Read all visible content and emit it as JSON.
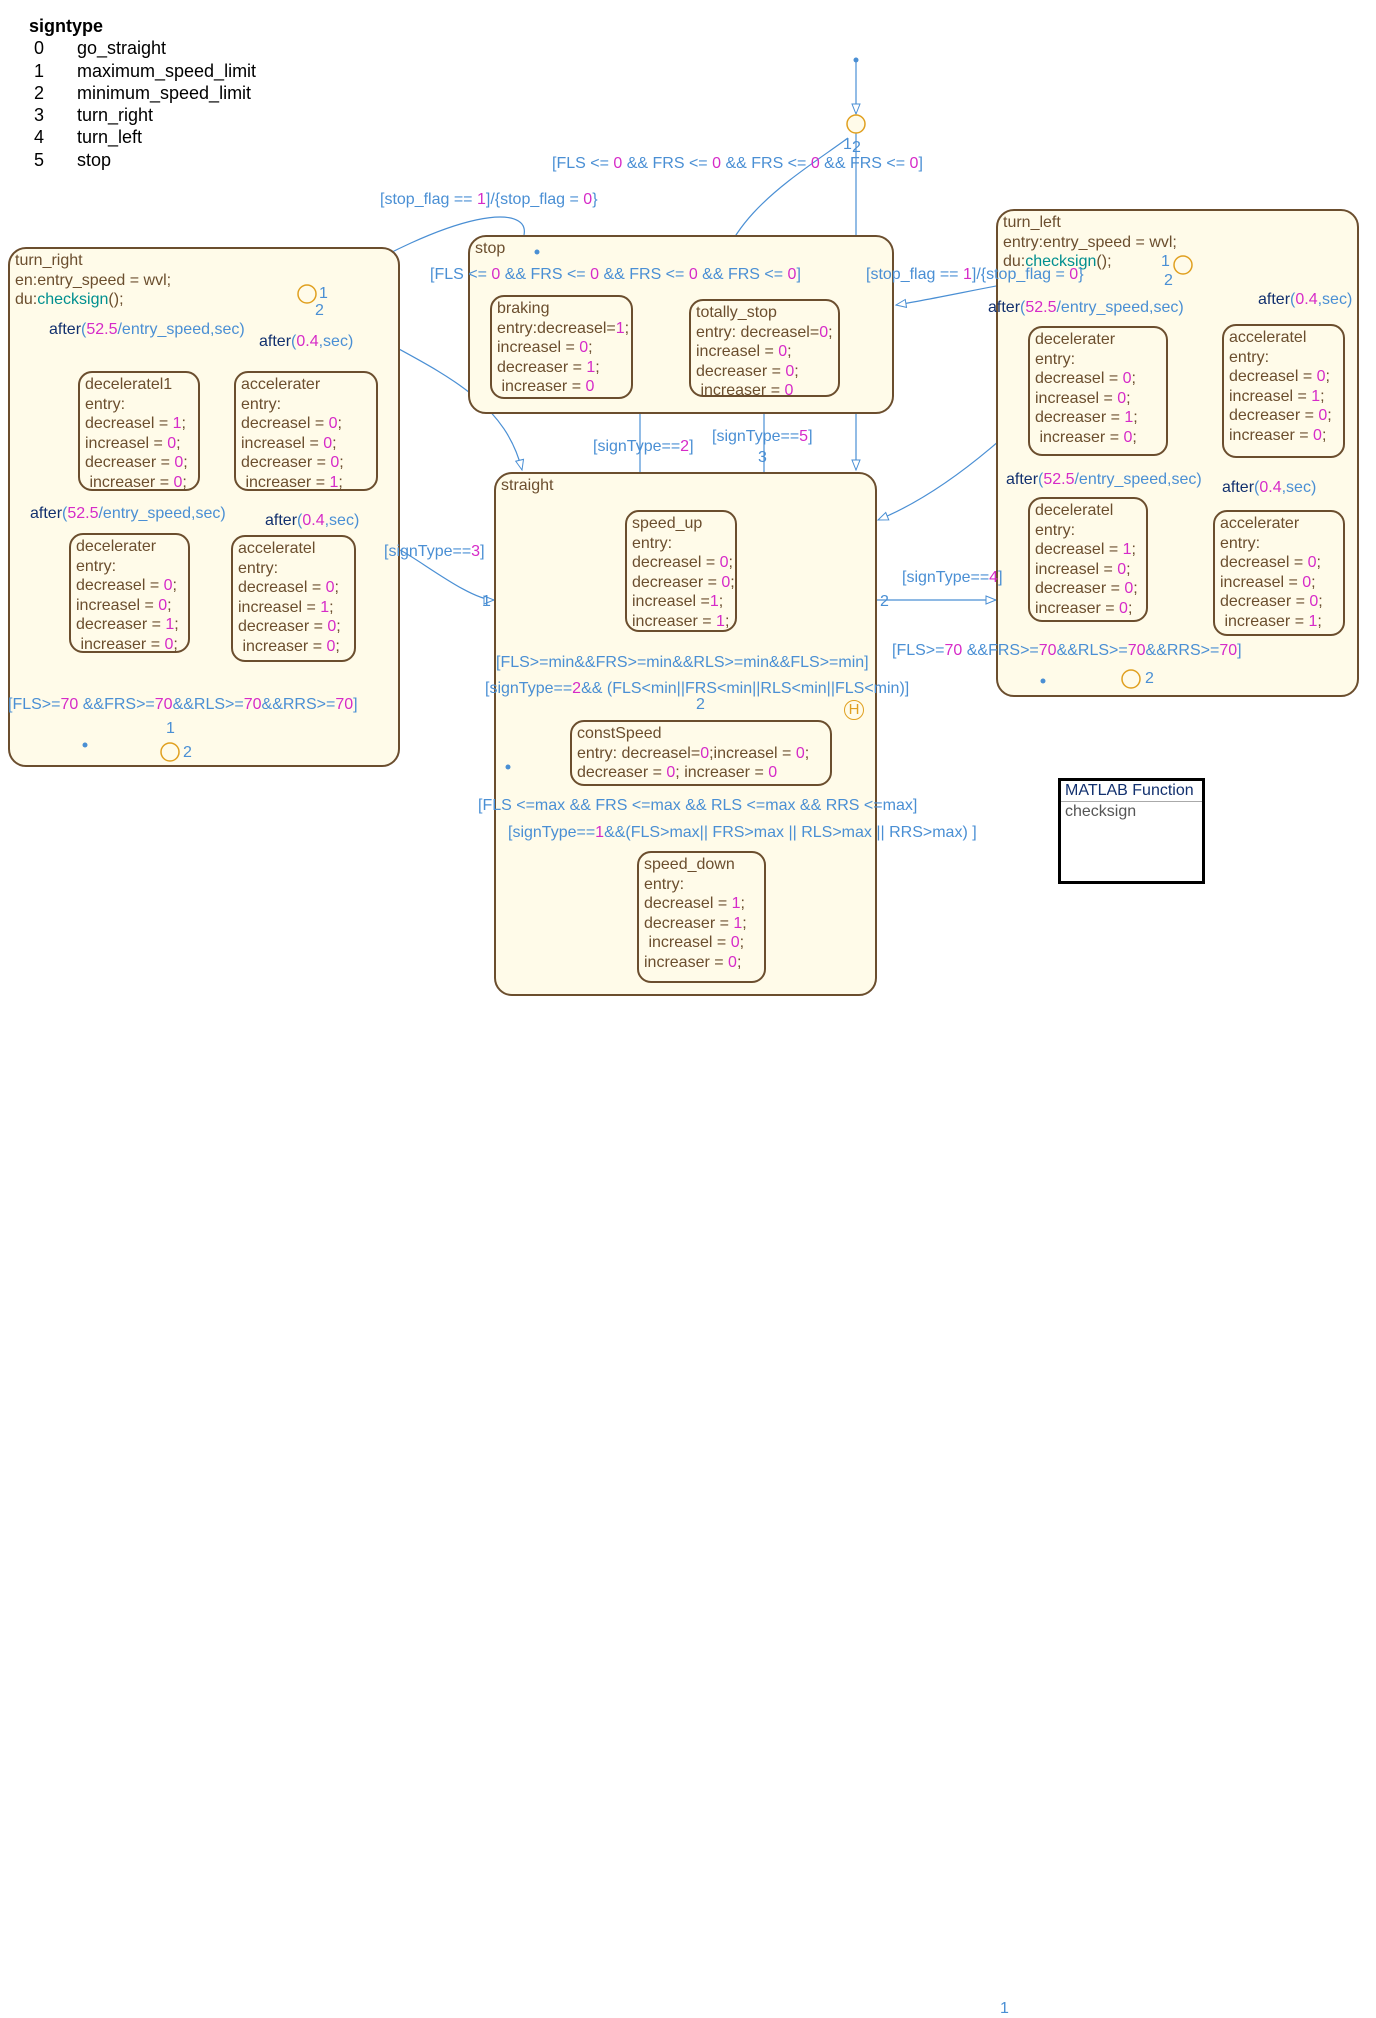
{
  "legend": {
    "title": "signtype",
    "rows": [
      [
        "0",
        "go_straight"
      ],
      [
        "1",
        "maximum_speed_limit"
      ],
      [
        "2",
        "minimum_speed_limit"
      ],
      [
        "3",
        "turn_right"
      ],
      [
        "4",
        "turn_left"
      ],
      [
        "5",
        "stop"
      ]
    ]
  },
  "colors": {
    "state_border": "#6b4e2e",
    "state_fill": "#fffbe9",
    "transition": "#4a8fd4",
    "junction": "#e0a020",
    "number": "#d62bc8",
    "function": "#008f8f"
  },
  "states": {
    "turn_right": [
      [
        [
          "turn_right",
          "b"
        ]
      ],
      [
        [
          "en:entry_speed = wvl;",
          "b"
        ]
      ],
      [
        [
          "du:",
          "b"
        ],
        [
          "checksign",
          "t"
        ],
        [
          "();",
          "b"
        ]
      ]
    ],
    "deceleratel1": [
      [
        [
          "deceleratel1",
          "b"
        ]
      ],
      [
        [
          "entry:",
          "b"
        ]
      ],
      [
        [
          "decreasel = ",
          "b"
        ],
        [
          "1",
          "m"
        ],
        [
          ";",
          "b"
        ]
      ],
      [
        [
          "increasel = ",
          "b"
        ],
        [
          "0",
          "m"
        ],
        [
          ";",
          "b"
        ]
      ],
      [
        [
          "decreaser = ",
          "b"
        ],
        [
          "0",
          "m"
        ],
        [
          ";",
          "b"
        ]
      ],
      [
        [
          " increaser = ",
          "b"
        ],
        [
          "0",
          "m"
        ],
        [
          ";",
          "b"
        ]
      ]
    ],
    "tr_accelerater": [
      [
        [
          "accelerater",
          "b"
        ]
      ],
      [
        [
          "entry:",
          "b"
        ]
      ],
      [
        [
          "decreasel = ",
          "b"
        ],
        [
          "0",
          "m"
        ],
        [
          ";",
          "b"
        ]
      ],
      [
        [
          "increasel = ",
          "b"
        ],
        [
          "0",
          "m"
        ],
        [
          ";",
          "b"
        ]
      ],
      [
        [
          "decreaser = ",
          "b"
        ],
        [
          "0",
          "m"
        ],
        [
          ";",
          "b"
        ]
      ],
      [
        [
          " increaser = ",
          "b"
        ],
        [
          "1",
          "m"
        ],
        [
          ";",
          "b"
        ]
      ]
    ],
    "tr_decelerater": [
      [
        [
          "decelerater",
          "b"
        ]
      ],
      [
        [
          "entry:",
          "b"
        ]
      ],
      [
        [
          "decreasel = ",
          "b"
        ],
        [
          "0",
          "m"
        ],
        [
          ";",
          "b"
        ]
      ],
      [
        [
          "increasel = ",
          "b"
        ],
        [
          "0",
          "m"
        ],
        [
          ";",
          "b"
        ]
      ],
      [
        [
          "decreaser = ",
          "b"
        ],
        [
          "1",
          "m"
        ],
        [
          ";",
          "b"
        ]
      ],
      [
        [
          " increaser = ",
          "b"
        ],
        [
          "0",
          "m"
        ],
        [
          ";",
          "b"
        ]
      ]
    ],
    "tr_acceleratel": [
      [
        [
          "acceleratel",
          "b"
        ]
      ],
      [
        [
          "entry:",
          "b"
        ]
      ],
      [
        [
          "decreasel = ",
          "b"
        ],
        [
          "0",
          "m"
        ],
        [
          ";",
          "b"
        ]
      ],
      [
        [
          "increasel = ",
          "b"
        ],
        [
          "1",
          "m"
        ],
        [
          ";",
          "b"
        ]
      ],
      [
        [
          "decreaser = ",
          "b"
        ],
        [
          "0",
          "m"
        ],
        [
          ";",
          "b"
        ]
      ],
      [
        [
          " increaser = ",
          "b"
        ],
        [
          "0",
          "m"
        ],
        [
          ";",
          "b"
        ]
      ]
    ],
    "stop": [
      [
        [
          "stop",
          "b"
        ]
      ]
    ],
    "braking": [
      [
        [
          "braking",
          "b"
        ]
      ],
      [
        [
          "entry:decreasel=",
          "b"
        ],
        [
          "1",
          "m"
        ],
        [
          ";",
          "b"
        ]
      ],
      [
        [
          "increasel = ",
          "b"
        ],
        [
          "0",
          "m"
        ],
        [
          ";",
          "b"
        ]
      ],
      [
        [
          "decreaser = ",
          "b"
        ],
        [
          "1",
          "m"
        ],
        [
          ";",
          "b"
        ]
      ],
      [
        [
          " increaser = ",
          "b"
        ],
        [
          "0",
          "m"
        ]
      ]
    ],
    "totally_stop": [
      [
        [
          "totally_stop",
          "b"
        ]
      ],
      [
        [
          "entry: decreasel=",
          "b"
        ],
        [
          "0",
          "m"
        ],
        [
          ";",
          "b"
        ]
      ],
      [
        [
          "increasel = ",
          "b"
        ],
        [
          "0",
          "m"
        ],
        [
          ";",
          "b"
        ]
      ],
      [
        [
          "decreaser = ",
          "b"
        ],
        [
          "0",
          "m"
        ],
        [
          ";",
          "b"
        ]
      ],
      [
        [
          " increaser = ",
          "b"
        ],
        [
          "0",
          "m"
        ]
      ]
    ],
    "straight": [
      [
        [
          "straight",
          "b"
        ]
      ]
    ],
    "speed_up": [
      [
        [
          "speed_up",
          "b"
        ]
      ],
      [
        [
          "entry:",
          "b"
        ]
      ],
      [
        [
          "decreasel = ",
          "b"
        ],
        [
          "0",
          "m"
        ],
        [
          ";",
          "b"
        ]
      ],
      [
        [
          "decreaser = ",
          "b"
        ],
        [
          "0",
          "m"
        ],
        [
          ";",
          "b"
        ]
      ],
      [
        [
          "increasel =",
          "b"
        ],
        [
          "1",
          "m"
        ],
        [
          ";",
          "b"
        ]
      ],
      [
        [
          "increaser = ",
          "b"
        ],
        [
          "1",
          "m"
        ],
        [
          ";",
          "b"
        ]
      ]
    ],
    "constSpeed": [
      [
        [
          "constSpeed",
          "b"
        ]
      ],
      [
        [
          "entry: decreasel=",
          "b"
        ],
        [
          "0",
          "m"
        ],
        [
          ";increasel = ",
          "b"
        ],
        [
          "0",
          "m"
        ],
        [
          ";",
          "b"
        ]
      ],
      [
        [
          "decreaser = ",
          "b"
        ],
        [
          "0",
          "m"
        ],
        [
          "; increaser = ",
          "b"
        ],
        [
          "0",
          "m"
        ]
      ]
    ],
    "speed_down": [
      [
        [
          "speed_down",
          "b"
        ]
      ],
      [
        [
          "entry:",
          "b"
        ]
      ],
      [
        [
          "decreasel = ",
          "b"
        ],
        [
          "1",
          "m"
        ],
        [
          ";",
          "b"
        ]
      ],
      [
        [
          "decreaser = ",
          "b"
        ],
        [
          "1",
          "m"
        ],
        [
          ";",
          "b"
        ]
      ],
      [
        [
          " increasel = ",
          "b"
        ],
        [
          "0",
          "m"
        ],
        [
          ";",
          "b"
        ]
      ],
      [
        [
          "increaser = ",
          "b"
        ],
        [
          "0",
          "m"
        ],
        [
          ";",
          "b"
        ]
      ]
    ],
    "turn_left": [
      [
        [
          "turn_left",
          "b"
        ]
      ],
      [
        [
          "entry:entry_speed = wvl;",
          "b"
        ]
      ],
      [
        [
          "du:",
          "b"
        ],
        [
          "checksign",
          "t"
        ],
        [
          "();",
          "b"
        ]
      ]
    ],
    "tl_decelerater": [
      [
        [
          "decelerater",
          "b"
        ]
      ],
      [
        [
          "entry:",
          "b"
        ]
      ],
      [
        [
          "decreasel = ",
          "b"
        ],
        [
          "0",
          "m"
        ],
        [
          ";",
          "b"
        ]
      ],
      [
        [
          "increasel = ",
          "b"
        ],
        [
          "0",
          "m"
        ],
        [
          ";",
          "b"
        ]
      ],
      [
        [
          "decreaser = ",
          "b"
        ],
        [
          "1",
          "m"
        ],
        [
          ";",
          "b"
        ]
      ],
      [
        [
          " increaser = ",
          "b"
        ],
        [
          "0",
          "m"
        ],
        [
          ";",
          "b"
        ]
      ]
    ],
    "tl_acceleratel": [
      [
        [
          "acceleratel",
          "b"
        ]
      ],
      [
        [
          "entry:",
          "b"
        ]
      ],
      [
        [
          "decreasel = ",
          "b"
        ],
        [
          "0",
          "m"
        ],
        [
          ";",
          "b"
        ]
      ],
      [
        [
          "increasel = ",
          "b"
        ],
        [
          "1",
          "m"
        ],
        [
          ";",
          "b"
        ]
      ],
      [
        [
          "decreaser = ",
          "b"
        ],
        [
          "0",
          "m"
        ],
        [
          ";",
          "b"
        ]
      ],
      [
        [
          "increaser = ",
          "b"
        ],
        [
          "0",
          "m"
        ],
        [
          ";",
          "b"
        ]
      ]
    ],
    "tl_deceleratel": [
      [
        [
          "deceleratel",
          "b"
        ]
      ],
      [
        [
          "entry:",
          "b"
        ]
      ],
      [
        [
          "decreasel = ",
          "b"
        ],
        [
          "1",
          "m"
        ],
        [
          ";",
          "b"
        ]
      ],
      [
        [
          "increasel = ",
          "b"
        ],
        [
          "0",
          "m"
        ],
        [
          ";",
          "b"
        ]
      ],
      [
        [
          "decreaser = ",
          "b"
        ],
        [
          "0",
          "m"
        ],
        [
          ";",
          "b"
        ]
      ],
      [
        [
          "increaser = ",
          "b"
        ],
        [
          "0",
          "m"
        ],
        [
          ";",
          "b"
        ]
      ]
    ],
    "tl_accelerater": [
      [
        [
          "accelerater",
          "b"
        ]
      ],
      [
        [
          "entry:",
          "b"
        ]
      ],
      [
        [
          "decreasel = ",
          "b"
        ],
        [
          "0",
          "m"
        ],
        [
          ";",
          "b"
        ]
      ],
      [
        [
          "increasel = ",
          "b"
        ],
        [
          "0",
          "m"
        ],
        [
          ";",
          "b"
        ]
      ],
      [
        [
          "decreaser = ",
          "b"
        ],
        [
          "0",
          "m"
        ],
        [
          ";",
          "b"
        ]
      ],
      [
        [
          " increaser = ",
          "b"
        ],
        [
          "1",
          "m"
        ],
        [
          ";",
          "b"
        ]
      ]
    ]
  },
  "labels": {
    "top_guard": [
      [
        "[FLS <= ",
        "l"
      ],
      [
        "0",
        "m"
      ],
      [
        " && FRS <= ",
        "l"
      ],
      [
        "0",
        "m"
      ],
      [
        " && FRS <= ",
        "l"
      ],
      [
        "0",
        "m"
      ],
      [
        " && FRS <= ",
        "l"
      ],
      [
        "0",
        "m"
      ],
      [
        "]",
        "l"
      ]
    ],
    "stopflag_left": [
      [
        "[stop_flag == ",
        "l"
      ],
      [
        "1",
        "m"
      ],
      [
        "]/{stop_flag = ",
        "l"
      ],
      [
        "0",
        "m"
      ],
      [
        "}",
        "l"
      ]
    ],
    "stop_guard": [
      [
        "[FLS <= ",
        "l"
      ],
      [
        "0",
        "m"
      ],
      [
        " && FRS <= ",
        "l"
      ],
      [
        "0",
        "m"
      ],
      [
        " && FRS <= ",
        "l"
      ],
      [
        "0",
        "m"
      ],
      [
        " && FRS <= ",
        "l"
      ],
      [
        "0",
        "m"
      ],
      [
        "]",
        "l"
      ]
    ],
    "stopflag_right": [
      [
        "[stop_flag == ",
        "l"
      ],
      [
        "1",
        "m"
      ],
      [
        "]/{stop_flag = ",
        "l"
      ],
      [
        "0",
        "m"
      ],
      [
        "}",
        "l"
      ]
    ],
    "sign2": [
      [
        "[signType==",
        "l"
      ],
      [
        "2",
        "m"
      ],
      [
        "]",
        "l"
      ]
    ],
    "sign5": [
      [
        "[signType==",
        "l"
      ],
      [
        "5",
        "m"
      ],
      [
        "]",
        "l"
      ]
    ],
    "sign3": [
      [
        "[signType==",
        "l"
      ],
      [
        "3",
        "m"
      ],
      [
        "]",
        "l"
      ]
    ],
    "sign4": [
      [
        "[signType==",
        "l"
      ],
      [
        "4",
        "m"
      ],
      [
        "]",
        "l"
      ]
    ],
    "tr_after1": [
      [
        "after",
        "d"
      ],
      [
        "(",
        "l"
      ],
      [
        "52.5",
        "m"
      ],
      [
        "/entry_speed,sec)",
        "l"
      ]
    ],
    "tr_after2": [
      [
        "after",
        "d"
      ],
      [
        "(",
        "l"
      ],
      [
        "0.4",
        "m"
      ],
      [
        ",sec)",
        "l"
      ]
    ],
    "tr_after3": [
      [
        "after",
        "d"
      ],
      [
        "(",
        "l"
      ],
      [
        "52.5",
        "m"
      ],
      [
        "/entry_speed,sec)",
        "l"
      ]
    ],
    "tr_after4": [
      [
        "after",
        "d"
      ],
      [
        "(",
        "l"
      ],
      [
        "0.4",
        "m"
      ],
      [
        ",sec)",
        "l"
      ]
    ],
    "tr_70": [
      [
        "[FLS>=",
        "l"
      ],
      [
        "70",
        "m"
      ],
      [
        " &&FRS>=",
        "l"
      ],
      [
        "70",
        "m"
      ],
      [
        "&&RLS>=",
        "l"
      ],
      [
        "70",
        "m"
      ],
      [
        "&&RRS>=",
        "l"
      ],
      [
        "70",
        "m"
      ],
      [
        "]",
        "l"
      ]
    ],
    "tl_after1": [
      [
        "after",
        "d"
      ],
      [
        "(",
        "l"
      ],
      [
        "52.5",
        "m"
      ],
      [
        "/entry_speed,sec)",
        "l"
      ]
    ],
    "tl_after2": [
      [
        "after",
        "d"
      ],
      [
        "(",
        "l"
      ],
      [
        "0.4",
        "m"
      ],
      [
        ",sec)",
        "l"
      ]
    ],
    "tl_after3": [
      [
        "after",
        "d"
      ],
      [
        "(",
        "l"
      ],
      [
        "52.5",
        "m"
      ],
      [
        "/entry_speed,sec)",
        "l"
      ]
    ],
    "tl_after4": [
      [
        "after",
        "d"
      ],
      [
        "(",
        "l"
      ],
      [
        "0.4",
        "m"
      ],
      [
        ",sec)",
        "l"
      ]
    ],
    "tl_70": [
      [
        "[FLS>=",
        "l"
      ],
      [
        "70",
        "m"
      ],
      [
        " &&FRS>=",
        "l"
      ],
      [
        "70",
        "m"
      ],
      [
        "&&RLS>=",
        "l"
      ],
      [
        "70",
        "m"
      ],
      [
        "&&RRS>=",
        "l"
      ],
      [
        "70",
        "m"
      ],
      [
        "]",
        "l"
      ]
    ],
    "min_guard": [
      [
        "[FLS>=min&&FRS>=min&&RLS>=min&&FLS>=min]",
        "l"
      ]
    ],
    "min_sign": [
      [
        "[signType==",
        "l"
      ],
      [
        "2",
        "m"
      ],
      [
        "&& (FLS<min||FRS<min||RLS<min||FLS<min)]",
        "l"
      ]
    ],
    "max_guard": [
      [
        "[FLS <=max && FRS <=max && RLS <=max && RRS <=max]",
        "l"
      ]
    ],
    "max_sign": [
      [
        "[signType==",
        "l"
      ],
      [
        "1",
        "m"
      ],
      [
        "&&(FLS>max|| FRS>max || RLS>max || RRS>max) ]",
        "l"
      ]
    ],
    "n_top1": [
      [
        "1",
        "l"
      ]
    ],
    "n_top2": [
      [
        "2",
        "l"
      ]
    ],
    "n_3": [
      [
        "3",
        "l"
      ]
    ],
    "n_tr1": [
      [
        "1",
        "l"
      ]
    ],
    "n_tr2": [
      [
        "2",
        "l"
      ]
    ],
    "n_trb1": [
      [
        "1",
        "l"
      ]
    ],
    "n_trb2": [
      [
        "2",
        "l"
      ]
    ],
    "n_tl1": [
      [
        "1",
        "l"
      ]
    ],
    "n_tl2": [
      [
        "2",
        "l"
      ]
    ],
    "n_tlb2": [
      [
        "2",
        "l"
      ]
    ],
    "n_s1": [
      [
        "1",
        "l"
      ]
    ],
    "n_s2": [
      [
        "2",
        "l"
      ]
    ],
    "n_c2": [
      [
        "2",
        "l"
      ]
    ],
    "n_c1": [
      [
        "1",
        "l"
      ]
    ]
  },
  "history_junction": "H",
  "matlab_function": {
    "title": "MATLAB Function",
    "name": "checksign"
  }
}
